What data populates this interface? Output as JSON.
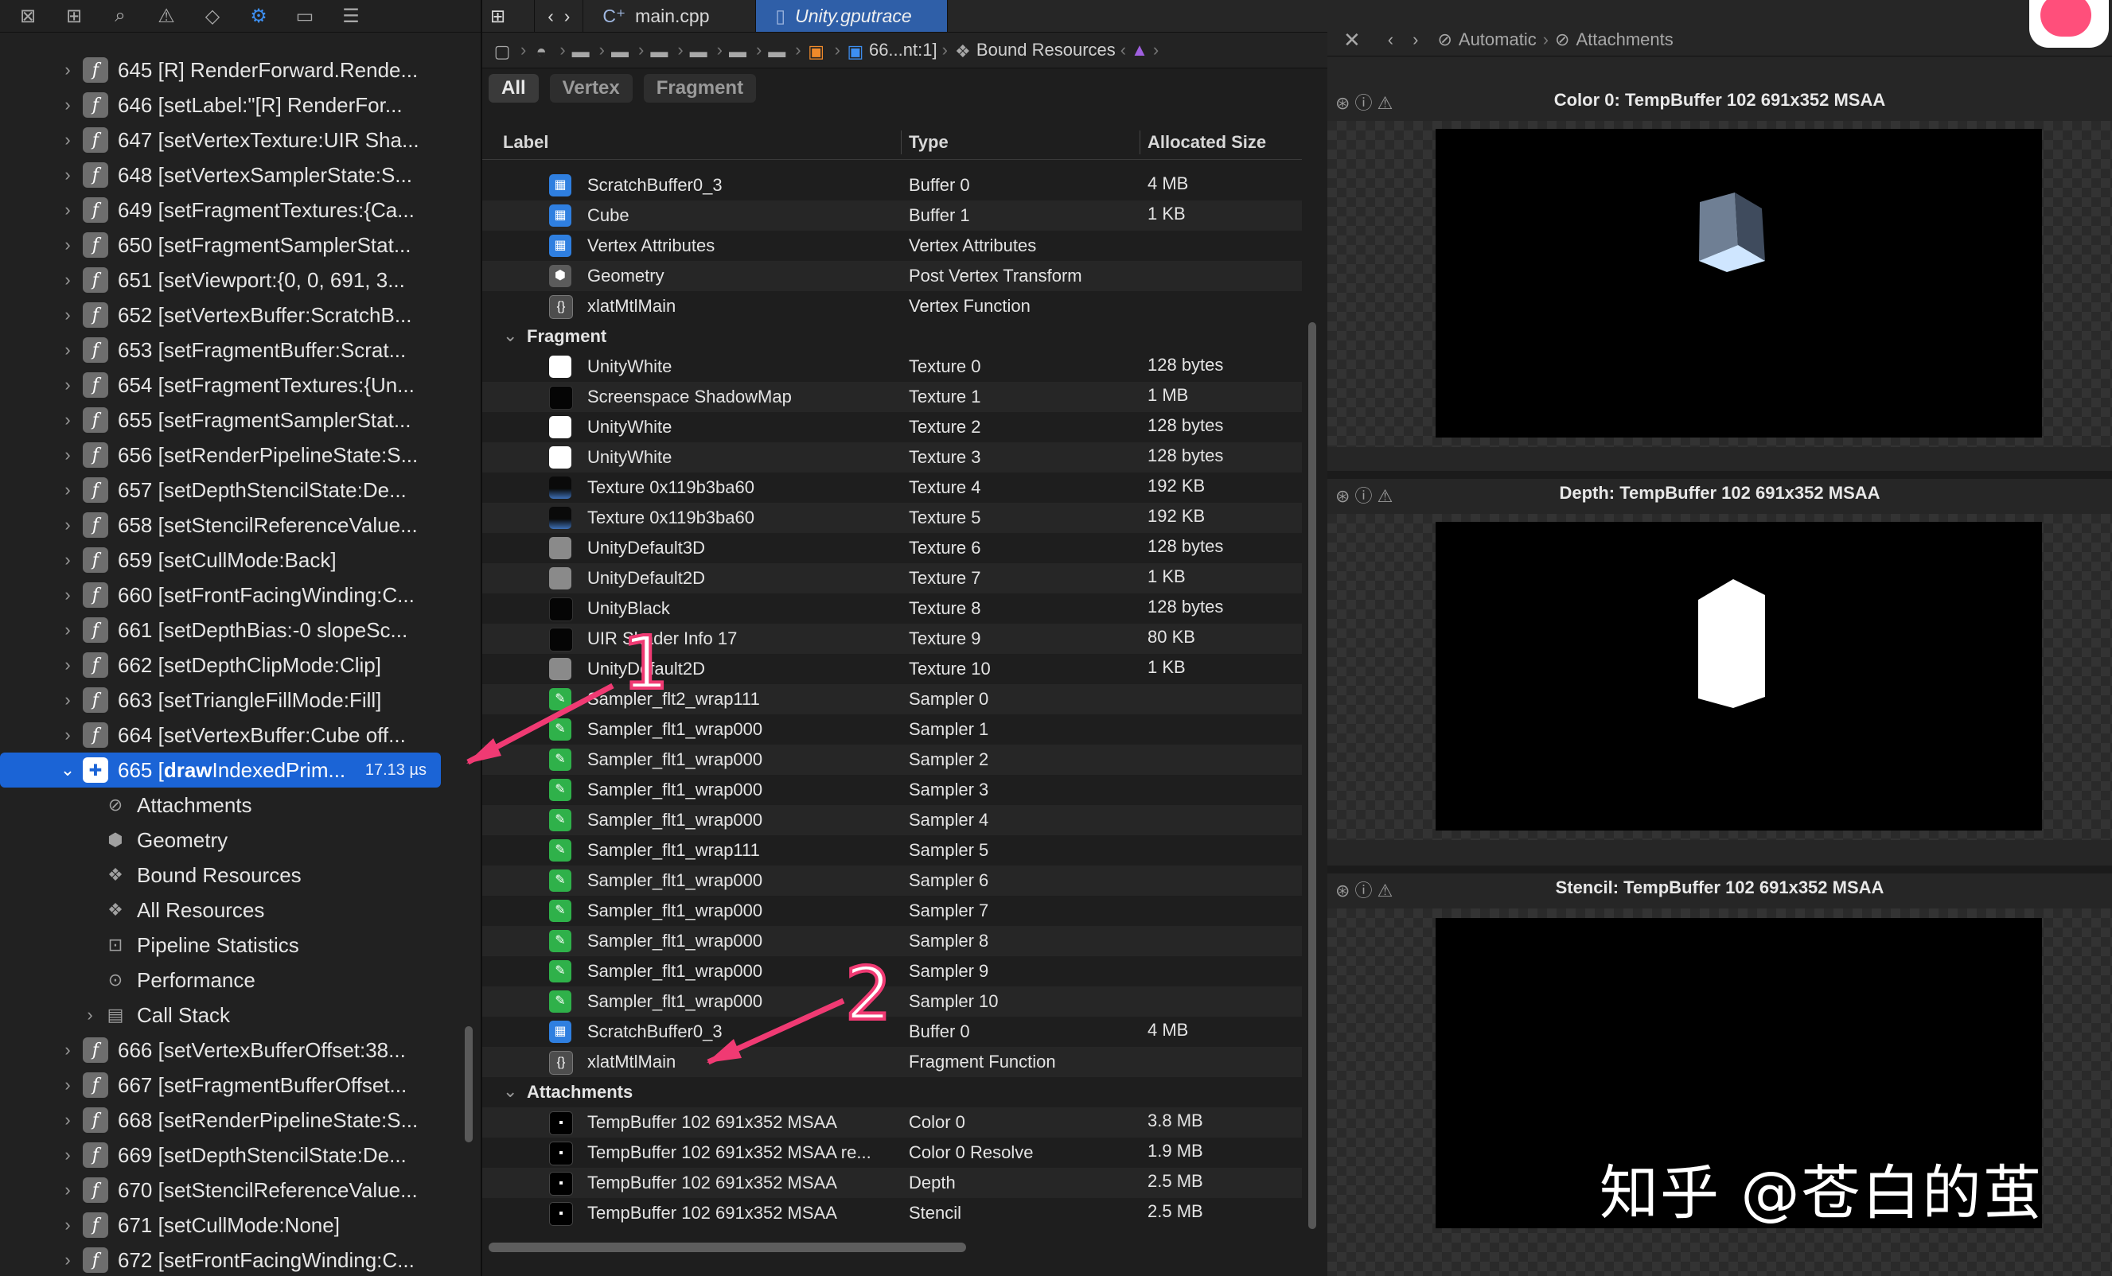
{
  "tabs": [
    {
      "label": "main.cpp",
      "icon": "C⁺"
    },
    {
      "label": "Unity.gputrace",
      "icon": "▯"
    }
  ],
  "jumpbar": {
    "crumb": "66...nt:1]",
    "section": "Bound Resources"
  },
  "right_jumpbar": {
    "mode": "Automatic",
    "section": "Attachments"
  },
  "filters": [
    "All",
    "Vertex",
    "Fragment"
  ],
  "columns": {
    "label": "Label",
    "type": "Type",
    "size": "Allocated Size"
  },
  "vertex_rows": [
    {
      "label": "ScratchBuffer0_3",
      "type": "Buffer 0",
      "size": "4 MB",
      "icon": "buffer-icon"
    },
    {
      "label": "Cube",
      "type": "Buffer 1",
      "size": "1 KB",
      "icon": "buffer-icon"
    },
    {
      "label": "Vertex Attributes",
      "type": "Vertex Attributes",
      "size": "",
      "icon": "buffer-icon"
    },
    {
      "label": "Geometry",
      "type": "Post Vertex Transform",
      "size": "",
      "icon": "geometry-icon"
    },
    {
      "label": "xlatMtlMain",
      "type": "Vertex Function",
      "size": "",
      "icon": "function-icon"
    }
  ],
  "fragment_group": "Fragment",
  "fragment_rows": [
    {
      "label": "UnityWhite",
      "type": "Texture 0",
      "size": "128 bytes",
      "icon": "texture-white"
    },
    {
      "label": "Screenspace ShadowMap",
      "type": "Texture 1",
      "size": "1 MB",
      "icon": "texture-black"
    },
    {
      "label": "UnityWhite",
      "type": "Texture 2",
      "size": "128 bytes",
      "icon": "texture-white"
    },
    {
      "label": "UnityWhite",
      "type": "Texture 3",
      "size": "128 bytes",
      "icon": "texture-white"
    },
    {
      "label": "Texture 0x119b3ba60",
      "type": "Texture 4",
      "size": "192 KB",
      "icon": "texture-dark"
    },
    {
      "label": "Texture 0x119b3ba60",
      "type": "Texture 5",
      "size": "192 KB",
      "icon": "texture-dark"
    },
    {
      "label": "UnityDefault3D",
      "type": "Texture 6",
      "size": "128 bytes",
      "icon": "texture-grey"
    },
    {
      "label": "UnityDefault2D",
      "type": "Texture 7",
      "size": "1 KB",
      "icon": "texture-grey"
    },
    {
      "label": "UnityBlack",
      "type": "Texture 8",
      "size": "128 bytes",
      "icon": "texture-black"
    },
    {
      "label": "UIR Shader Info 17",
      "type": "Texture 9",
      "size": "80 KB",
      "icon": "texture-black"
    },
    {
      "label": "UnityDefault2D",
      "type": "Texture 10",
      "size": "1 KB",
      "icon": "texture-grey"
    },
    {
      "label": "Sampler_flt2_wrap111",
      "type": "Sampler 0",
      "size": "",
      "icon": "sampler-icon"
    },
    {
      "label": "Sampler_flt1_wrap000",
      "type": "Sampler 1",
      "size": "",
      "icon": "sampler-icon"
    },
    {
      "label": "Sampler_flt1_wrap000",
      "type": "Sampler 2",
      "size": "",
      "icon": "sampler-icon"
    },
    {
      "label": "Sampler_flt1_wrap000",
      "type": "Sampler 3",
      "size": "",
      "icon": "sampler-icon"
    },
    {
      "label": "Sampler_flt1_wrap000",
      "type": "Sampler 4",
      "size": "",
      "icon": "sampler-icon"
    },
    {
      "label": "Sampler_flt1_wrap111",
      "type": "Sampler 5",
      "size": "",
      "icon": "sampler-icon"
    },
    {
      "label": "Sampler_flt1_wrap000",
      "type": "Sampler 6",
      "size": "",
      "icon": "sampler-icon"
    },
    {
      "label": "Sampler_flt1_wrap000",
      "type": "Sampler 7",
      "size": "",
      "icon": "sampler-icon"
    },
    {
      "label": "Sampler_flt1_wrap000",
      "type": "Sampler 8",
      "size": "",
      "icon": "sampler-icon"
    },
    {
      "label": "Sampler_flt1_wrap000",
      "type": "Sampler 9",
      "size": "",
      "icon": "sampler-icon"
    },
    {
      "label": "Sampler_flt1_wrap000",
      "type": "Sampler 10",
      "size": "",
      "icon": "sampler-icon"
    },
    {
      "label": "ScratchBuffer0_3",
      "type": "Buffer 0",
      "size": "4 MB",
      "icon": "buffer-icon"
    },
    {
      "label": "xlatMtlMain",
      "type": "Fragment Function",
      "size": "",
      "icon": "function-icon"
    }
  ],
  "attachments_group": "Attachments",
  "attachment_rows": [
    {
      "label": "TempBuffer 102 691x352 MSAA",
      "type": "Color 0",
      "size": "3.8 MB",
      "icon": "attachment-icon"
    },
    {
      "label": "TempBuffer 102 691x352 MSAA re...",
      "type": "Color 0 Resolve",
      "size": "1.9 MB",
      "icon": "attachment-icon"
    },
    {
      "label": "TempBuffer 102 691x352 MSAA",
      "type": "Depth",
      "size": "2.5 MB",
      "icon": "attachment-icon"
    },
    {
      "label": "TempBuffer 102 691x352 MSAA",
      "type": "Stencil",
      "size": "2.5 MB",
      "icon": "attachment-icon"
    }
  ],
  "navigator": {
    "before": [
      "645 [R] RenderForward.Rende...",
      "646 [setLabel:\"[R] RenderFor...",
      "647 [setVertexTexture:UIR Sha...",
      "648 [setVertexSamplerState:S...",
      "649 [setFragmentTextures:{Ca...",
      "650 [setFragmentSamplerStat...",
      "651 [setViewport:{0, 0, 691, 3...",
      "652 [setVertexBuffer:ScratchB...",
      "653 [setFragmentBuffer:Scrat...",
      "654 [setFragmentTextures:{Un...",
      "655 [setFragmentSamplerStat...",
      "656 [setRenderPipelineState:S...",
      "657 [setDepthStencilState:De...",
      "658 [setStencilReferenceValue...",
      "659 [setCullMode:Back]",
      "660 [setFrontFacingWinding:C...",
      "661 [setDepthBias:-0 slopeSc...",
      "662 [setDepthClipMode:Clip]",
      "663 [setTriangleFillMode:Fill]",
      "664 [setVertexBuffer:Cube off..."
    ],
    "selected": {
      "prefix": "665 [",
      "bold": "draw",
      "rest": "IndexedPrim...",
      "duration": "17.13 µs"
    },
    "children": [
      {
        "label": "Attachments",
        "icon": "attachments-icon"
      },
      {
        "label": "Geometry",
        "icon": "geometry-icon"
      },
      {
        "label": "Bound Resources",
        "icon": "bound-resources-icon"
      },
      {
        "label": "All Resources",
        "icon": "all-resources-icon"
      },
      {
        "label": "Pipeline Statistics",
        "icon": "pipeline-statistics-icon"
      },
      {
        "label": "Performance",
        "icon": "performance-icon"
      }
    ],
    "call_stack": "Call Stack",
    "after": [
      "666 [setVertexBufferOffset:38...",
      "667 [setFragmentBufferOffset...",
      "668 [setRenderPipelineState:S...",
      "669 [setDepthStencilState:De...",
      "670 [setStencilReferenceValue...",
      "671 [setCullMode:None]",
      "672 [setFrontFacingWinding:C..."
    ]
  },
  "previews": [
    {
      "title": "Color 0: TempBuffer 102 691x352 MSAA",
      "kind": "color"
    },
    {
      "title": "Depth: TempBuffer 102 691x352 MSAA",
      "kind": "depth"
    },
    {
      "title": "Stencil: TempBuffer 102 691x352 MSAA",
      "kind": "stencil"
    }
  ],
  "annotations": [
    "1",
    "2"
  ],
  "watermark": "知乎 @苍白的茧",
  "colors": {
    "selection": "#1b64d6",
    "annotation": "#f03a73",
    "buffer": "#2f7fe0",
    "sampler": "#2fb14a"
  }
}
